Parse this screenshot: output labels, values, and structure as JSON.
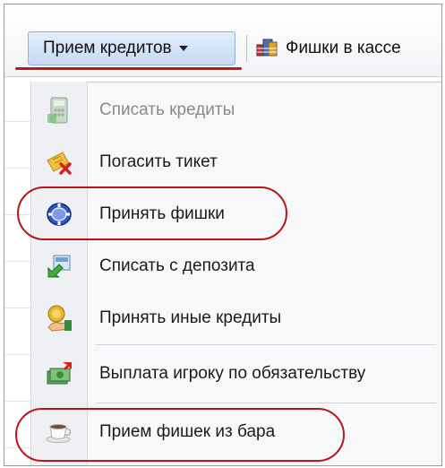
{
  "toolbar": {
    "primary_label": "Прием кредитов",
    "second_label": "Фишки в кассе"
  },
  "menu": {
    "items": [
      {
        "label": "Списать кредиты",
        "icon": "write-off-credits-icon",
        "disabled": true
      },
      {
        "label": "Погасить тикет",
        "icon": "redeem-ticket-icon",
        "disabled": false
      },
      {
        "label": "Принять фишки",
        "icon": "casino-chip-icon",
        "disabled": false
      },
      {
        "label": "Списать с депозита",
        "icon": "deposit-write-off-icon",
        "disabled": false
      },
      {
        "label": "Принять иные кредиты",
        "icon": "other-credits-icon",
        "disabled": false
      },
      {
        "label": "Выплата игроку по обязательству",
        "icon": "money-payout-icon",
        "disabled": false
      },
      {
        "label": "Прием фишек из бара",
        "icon": "coffee-cup-icon",
        "disabled": false
      }
    ]
  },
  "colors": {
    "highlight_annotation": "#b8151b",
    "toolbar_button": "#c5daf3"
  }
}
